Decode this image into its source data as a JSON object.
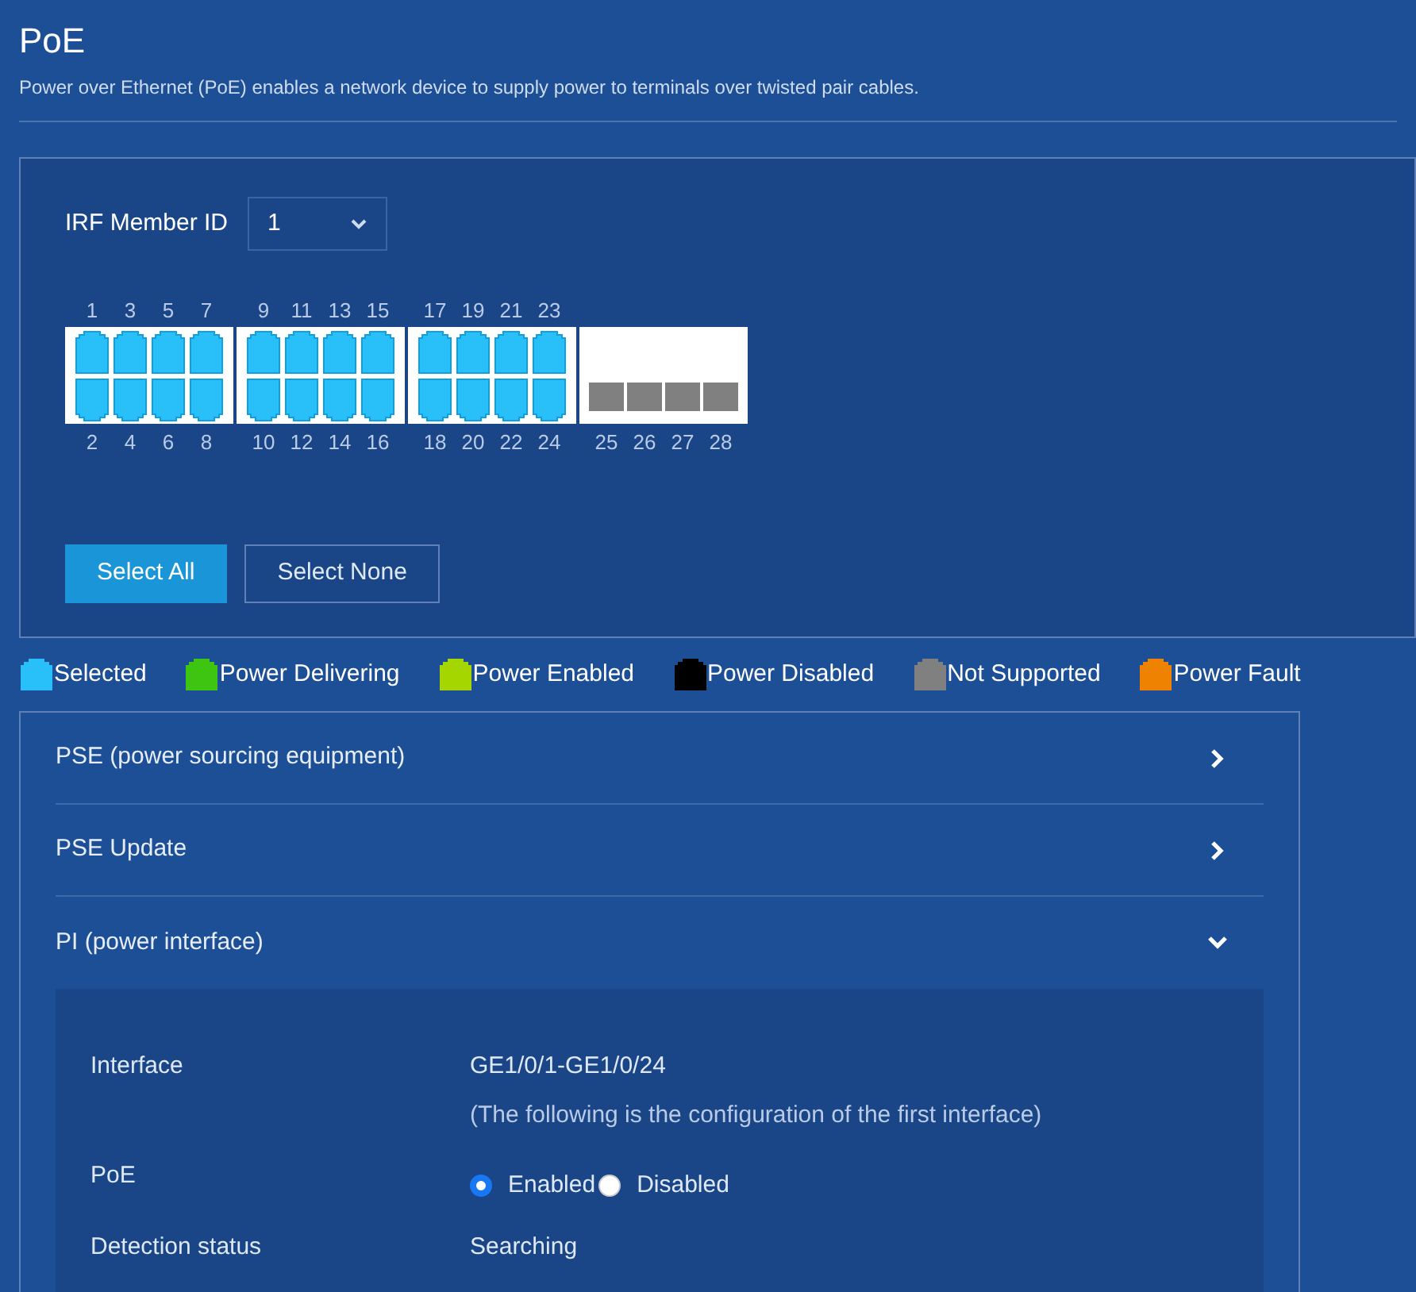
{
  "page": {
    "title": "PoE",
    "description": "Power over Ethernet (PoE) enables a network device to supply power to terminals over twisted pair cables."
  },
  "member": {
    "label": "IRF Member ID",
    "value": "1"
  },
  "port_groups": [
    {
      "kind": "dual",
      "columns": [
        {
          "top": {
            "label": "1",
            "color": "#29bff9"
          },
          "bottom": {
            "label": "2",
            "color": "#29bff9"
          }
        },
        {
          "top": {
            "label": "3",
            "color": "#29bff9"
          },
          "bottom": {
            "label": "4",
            "color": "#29bff9"
          }
        },
        {
          "top": {
            "label": "5",
            "color": "#29bff9"
          },
          "bottom": {
            "label": "6",
            "color": "#29bff9"
          }
        },
        {
          "top": {
            "label": "7",
            "color": "#29bff9"
          },
          "bottom": {
            "label": "8",
            "color": "#29bff9"
          }
        }
      ]
    },
    {
      "kind": "dual",
      "columns": [
        {
          "top": {
            "label": "9",
            "color": "#29bff9"
          },
          "bottom": {
            "label": "10",
            "color": "#29bff9"
          }
        },
        {
          "top": {
            "label": "11",
            "color": "#29bff9"
          },
          "bottom": {
            "label": "12",
            "color": "#29bff9"
          }
        },
        {
          "top": {
            "label": "13",
            "color": "#29bff9"
          },
          "bottom": {
            "label": "14",
            "color": "#29bff9"
          }
        },
        {
          "top": {
            "label": "15",
            "color": "#29bff9"
          },
          "bottom": {
            "label": "16",
            "color": "#29bff9"
          }
        }
      ]
    },
    {
      "kind": "dual",
      "columns": [
        {
          "top": {
            "label": "17",
            "color": "#29bff9"
          },
          "bottom": {
            "label": "18",
            "color": "#29bff9"
          }
        },
        {
          "top": {
            "label": "19",
            "color": "#29bff9"
          },
          "bottom": {
            "label": "20",
            "color": "#29bff9"
          }
        },
        {
          "top": {
            "label": "21",
            "color": "#29bff9"
          },
          "bottom": {
            "label": "22",
            "color": "#29bff9"
          }
        },
        {
          "top": {
            "label": "23",
            "color": "#29bff9"
          },
          "bottom": {
            "label": "24",
            "color": "#29bff9"
          }
        }
      ]
    },
    {
      "kind": "single",
      "columns": [
        {
          "bottom": {
            "label": "25",
            "color": "#808080"
          }
        },
        {
          "bottom": {
            "label": "26",
            "color": "#808080"
          }
        },
        {
          "bottom": {
            "label": "27",
            "color": "#808080"
          }
        },
        {
          "bottom": {
            "label": "28",
            "color": "#808080"
          }
        }
      ]
    }
  ],
  "buttons": [
    {
      "label": "Select All",
      "kind": "primary"
    },
    {
      "label": "Select None",
      "kind": "outline"
    }
  ],
  "legend": [
    {
      "label": "Selected",
      "color": "#29bff9"
    },
    {
      "label": "Power Delivering",
      "color": "#3ec511"
    },
    {
      "label": "Power Enabled",
      "color": "#a6d600"
    },
    {
      "label": "Power Disabled",
      "color": "#000000"
    },
    {
      "label": "Not Supported",
      "color": "#808080"
    },
    {
      "label": "Power Fault",
      "color": "#ef8200"
    }
  ],
  "sections": [
    {
      "title": "PSE (power sourcing equipment)",
      "expanded": false
    },
    {
      "title": "PSE Update",
      "expanded": false
    },
    {
      "title": "PI (power interface)",
      "expanded": true,
      "fields": [
        {
          "kind": "text",
          "label": "Interface",
          "lines": [
            "GE1/0/1-GE1/0/24",
            "(The following is the configuration of the first interface)"
          ]
        },
        {
          "kind": "radio",
          "label": "PoE",
          "options": [
            {
              "label": "Enabled",
              "selected": true
            },
            {
              "label": "Disabled",
              "selected": false
            }
          ]
        },
        {
          "kind": "text",
          "label": "Detection status",
          "lines": [
            "Searching"
          ]
        }
      ]
    }
  ]
}
